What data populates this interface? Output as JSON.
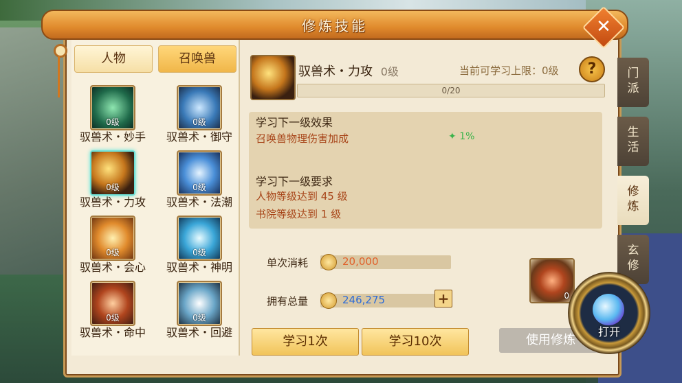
{
  "window": {
    "title": "修炼技能",
    "close_glyph": "✕"
  },
  "tabs": {
    "person": "人物",
    "summon": "召唤兽"
  },
  "skills": [
    {
      "name": "驭兽术・妙手",
      "level": "0级",
      "icon": "green-pillar-icon"
    },
    {
      "name": "驭兽术・御守",
      "level": "0级",
      "icon": "blue-shield-icon"
    },
    {
      "name": "驭兽术・力攻",
      "level": "0级",
      "icon": "golden-fist-icon",
      "selected": true
    },
    {
      "name": "驭兽术・法潮",
      "level": "0级",
      "icon": "blue-wave-icon"
    },
    {
      "name": "驭兽术・会心",
      "level": "0级",
      "icon": "golden-burst-icon"
    },
    {
      "name": "驭兽术・神明",
      "level": "0级",
      "icon": "blue-rune-icon"
    },
    {
      "name": "驭兽术・命中",
      "level": "0级",
      "icon": "target-sigil-icon"
    },
    {
      "name": "驭兽术・回避",
      "level": "0级",
      "icon": "dash-runner-icon"
    }
  ],
  "detail": {
    "name": "驭兽术・力攻",
    "level": "0级",
    "cap": "当前可学习上限：0级",
    "help": "?",
    "progress": {
      "current": 0,
      "max": 20,
      "text": "0/20"
    },
    "next_effect_title": "学习下一级效果",
    "next_effect_text": "召唤兽物理伤害加成",
    "next_effect_gain": "1%",
    "next_req_title": "学习下一级要求",
    "req_1": "人物等级达到 45 级",
    "req_2": "书院等级达到 1 级"
  },
  "cost": {
    "single_label": "单次消耗",
    "single_value": "20,000",
    "total_label": "拥有总量",
    "total_value": "246,275",
    "plus": "+"
  },
  "buttons": {
    "learn_1": "学习1次",
    "learn_10": "学习10次",
    "use_item": "使用修炼"
  },
  "item": {
    "count": "0"
  },
  "side_tabs": [
    {
      "label": "门派"
    },
    {
      "label": "生活"
    },
    {
      "label": "修炼",
      "active": true
    },
    {
      "label": "玄修"
    }
  ],
  "ring": {
    "label": "打开"
  },
  "colors": {
    "accent": "#e08a2c",
    "panel": "#f3ead6",
    "gain": "#3ab34a",
    "cost": "#e0602a",
    "total": "#2a6ad8"
  }
}
